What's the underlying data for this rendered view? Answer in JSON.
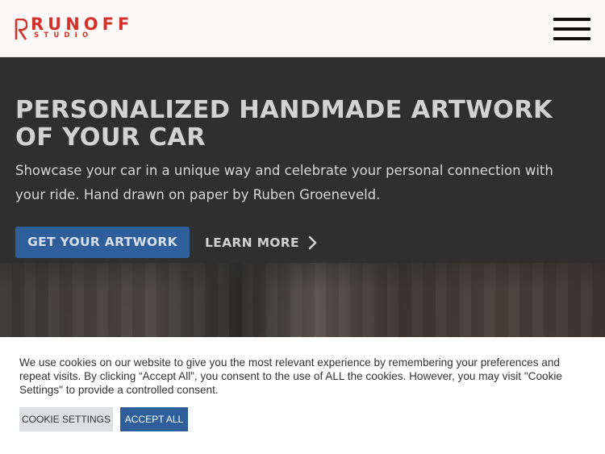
{
  "header": {
    "logo_word": "RUNOFF",
    "logo_sub": "STUDIO",
    "brand_color": "#d4312b",
    "menu_icon": "hamburger-menu-icon"
  },
  "hero": {
    "title": "PERSONALIZED HANDMADE ARTWORK OF YOUR CAR",
    "subtitle": "Showcase your car in a unique way and celebrate your personal connection with your ride. Hand drawn on paper by Ruben Groeneveld.",
    "primary_cta": "GET YOUR ARTWORK",
    "secondary_cta": "LEARN MORE",
    "secondary_icon": "chevron-right-icon",
    "accent_color": "#2e5f9a"
  },
  "cookie_banner": {
    "text": "We use cookies on our website to give you the most relevant experience by remembering your preferences and repeat visits. By clicking “Accept All”, you consent to the use of ALL the cookies. However, you may visit \"Cookie Settings\" to provide a controlled consent.",
    "settings_label": "Cookie Settings",
    "accept_label": "Accept All"
  }
}
